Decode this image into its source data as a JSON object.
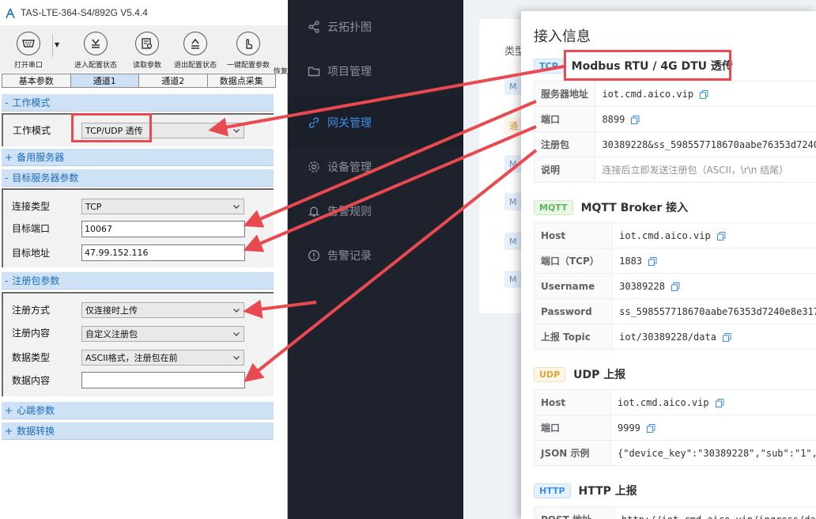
{
  "webapp": {
    "nav": [
      {
        "label": "云拓扑图",
        "icon": "share-icon"
      },
      {
        "label": "项目管理",
        "icon": "folder-icon"
      },
      {
        "label": "网关管理",
        "icon": "link-icon"
      },
      {
        "label": "设备管理",
        "icon": "gear-icon"
      },
      {
        "label": "告警规则",
        "icon": "bell-icon"
      },
      {
        "label": "告警记录",
        "icon": "alert-circle-icon"
      }
    ],
    "card_label": "类型",
    "tag_text": "M",
    "tag_text_alt": "通"
  },
  "drawer": {
    "title": "接入信息",
    "tcp": {
      "badge": "TCP",
      "title": "Modbus RTU / 4G DTU 透传",
      "rows": [
        {
          "key": "服务器地址",
          "value": "iot.cmd.aico.vip",
          "copy": true
        },
        {
          "key": "端口",
          "value": "8899",
          "copy": true
        },
        {
          "key": "注册包",
          "value": "30389228&ss_598557718670aabe76353d7240",
          "copy": false
        },
        {
          "key": "说明",
          "value": "连接后立即发送注册包（ASCII，\\r\\n 结尾）",
          "copy": false
        }
      ]
    },
    "mqtt": {
      "badge": "MQTT",
      "title": "MQTT Broker 接入",
      "rows": [
        {
          "key": "Host",
          "value": "iot.cmd.aico.vip",
          "copy": true
        },
        {
          "key": "端口（TCP）",
          "value": "1883",
          "copy": true
        },
        {
          "key": "Username",
          "value": "30389228",
          "copy": true
        },
        {
          "key": "Password",
          "value": "ss_598557718670aabe76353d7240e8e317",
          "copy": false
        },
        {
          "key": "上报 Topic",
          "value": "iot/30389228/data",
          "copy": true
        }
      ]
    },
    "udp": {
      "badge": "UDP",
      "title": "UDP 上报",
      "rows": [
        {
          "key": "Host",
          "value": "iot.cmd.aico.vip",
          "copy": true
        },
        {
          "key": "端口",
          "value": "9999",
          "copy": true
        },
        {
          "key": "JSON 示例",
          "value": "{\"device_key\":\"30389228\",\"sub\":\"1\",",
          "copy": false
        }
      ]
    },
    "http": {
      "badge": "HTTP",
      "title": "HTTP 上报",
      "rows": [
        {
          "key": "POST 地址",
          "value": "http://iot.cmd.aico.vip/ingress/da",
          "copy": false
        }
      ]
    }
  },
  "config_tool": {
    "title": "TAS-LTE-364-S4/892G V5.4.4",
    "toolbar": [
      {
        "label": "打开串口",
        "icon": "serial-port-icon"
      },
      {
        "label": "进入配置状态",
        "icon": "enter-config-icon"
      },
      {
        "label": "读取参数",
        "icon": "read-params-icon"
      },
      {
        "label": "退出配置状态",
        "icon": "exit-config-icon"
      },
      {
        "label": "一键配置参数",
        "icon": "hand-click-icon"
      },
      {
        "label": "恢复",
        "icon": "restore-icon"
      }
    ],
    "tabs": [
      "基本参数",
      "通道1",
      "通道2",
      "数据点采集"
    ],
    "active_tab": "通道1",
    "groups": {
      "work_mode": {
        "sign": "-",
        "label": "工作模式"
      },
      "backup_server": {
        "sign": "+",
        "label": "备用服务器"
      },
      "target_server": {
        "sign": "-",
        "label": "目标服务器参数"
      },
      "register": {
        "sign": "-",
        "label": "注册包参数"
      },
      "heartbeat": {
        "sign": "+",
        "label": "心跳参数"
      },
      "data_convert": {
        "sign": "+",
        "label": "数据转换"
      }
    },
    "fields": {
      "work_mode_label": "工作模式",
      "work_mode_value": "TCP/UDP 透传",
      "conn_type_label": "连接类型",
      "conn_type_value": "TCP",
      "target_port_label": "目标端口",
      "target_port_value": "10067",
      "target_addr_label": "目标地址",
      "target_addr_value": "47.99.152.116",
      "reg_mode_label": "注册方式",
      "reg_mode_value": "仅连接时上传",
      "reg_content_label": "注册内容",
      "reg_content_value": "自定义注册包",
      "data_type_label": "数据类型",
      "data_type_value": "ASCII格式，注册包在前",
      "data_content_label": "数据内容",
      "data_content_value": ""
    }
  },
  "annotation_color": "#e84a4f"
}
